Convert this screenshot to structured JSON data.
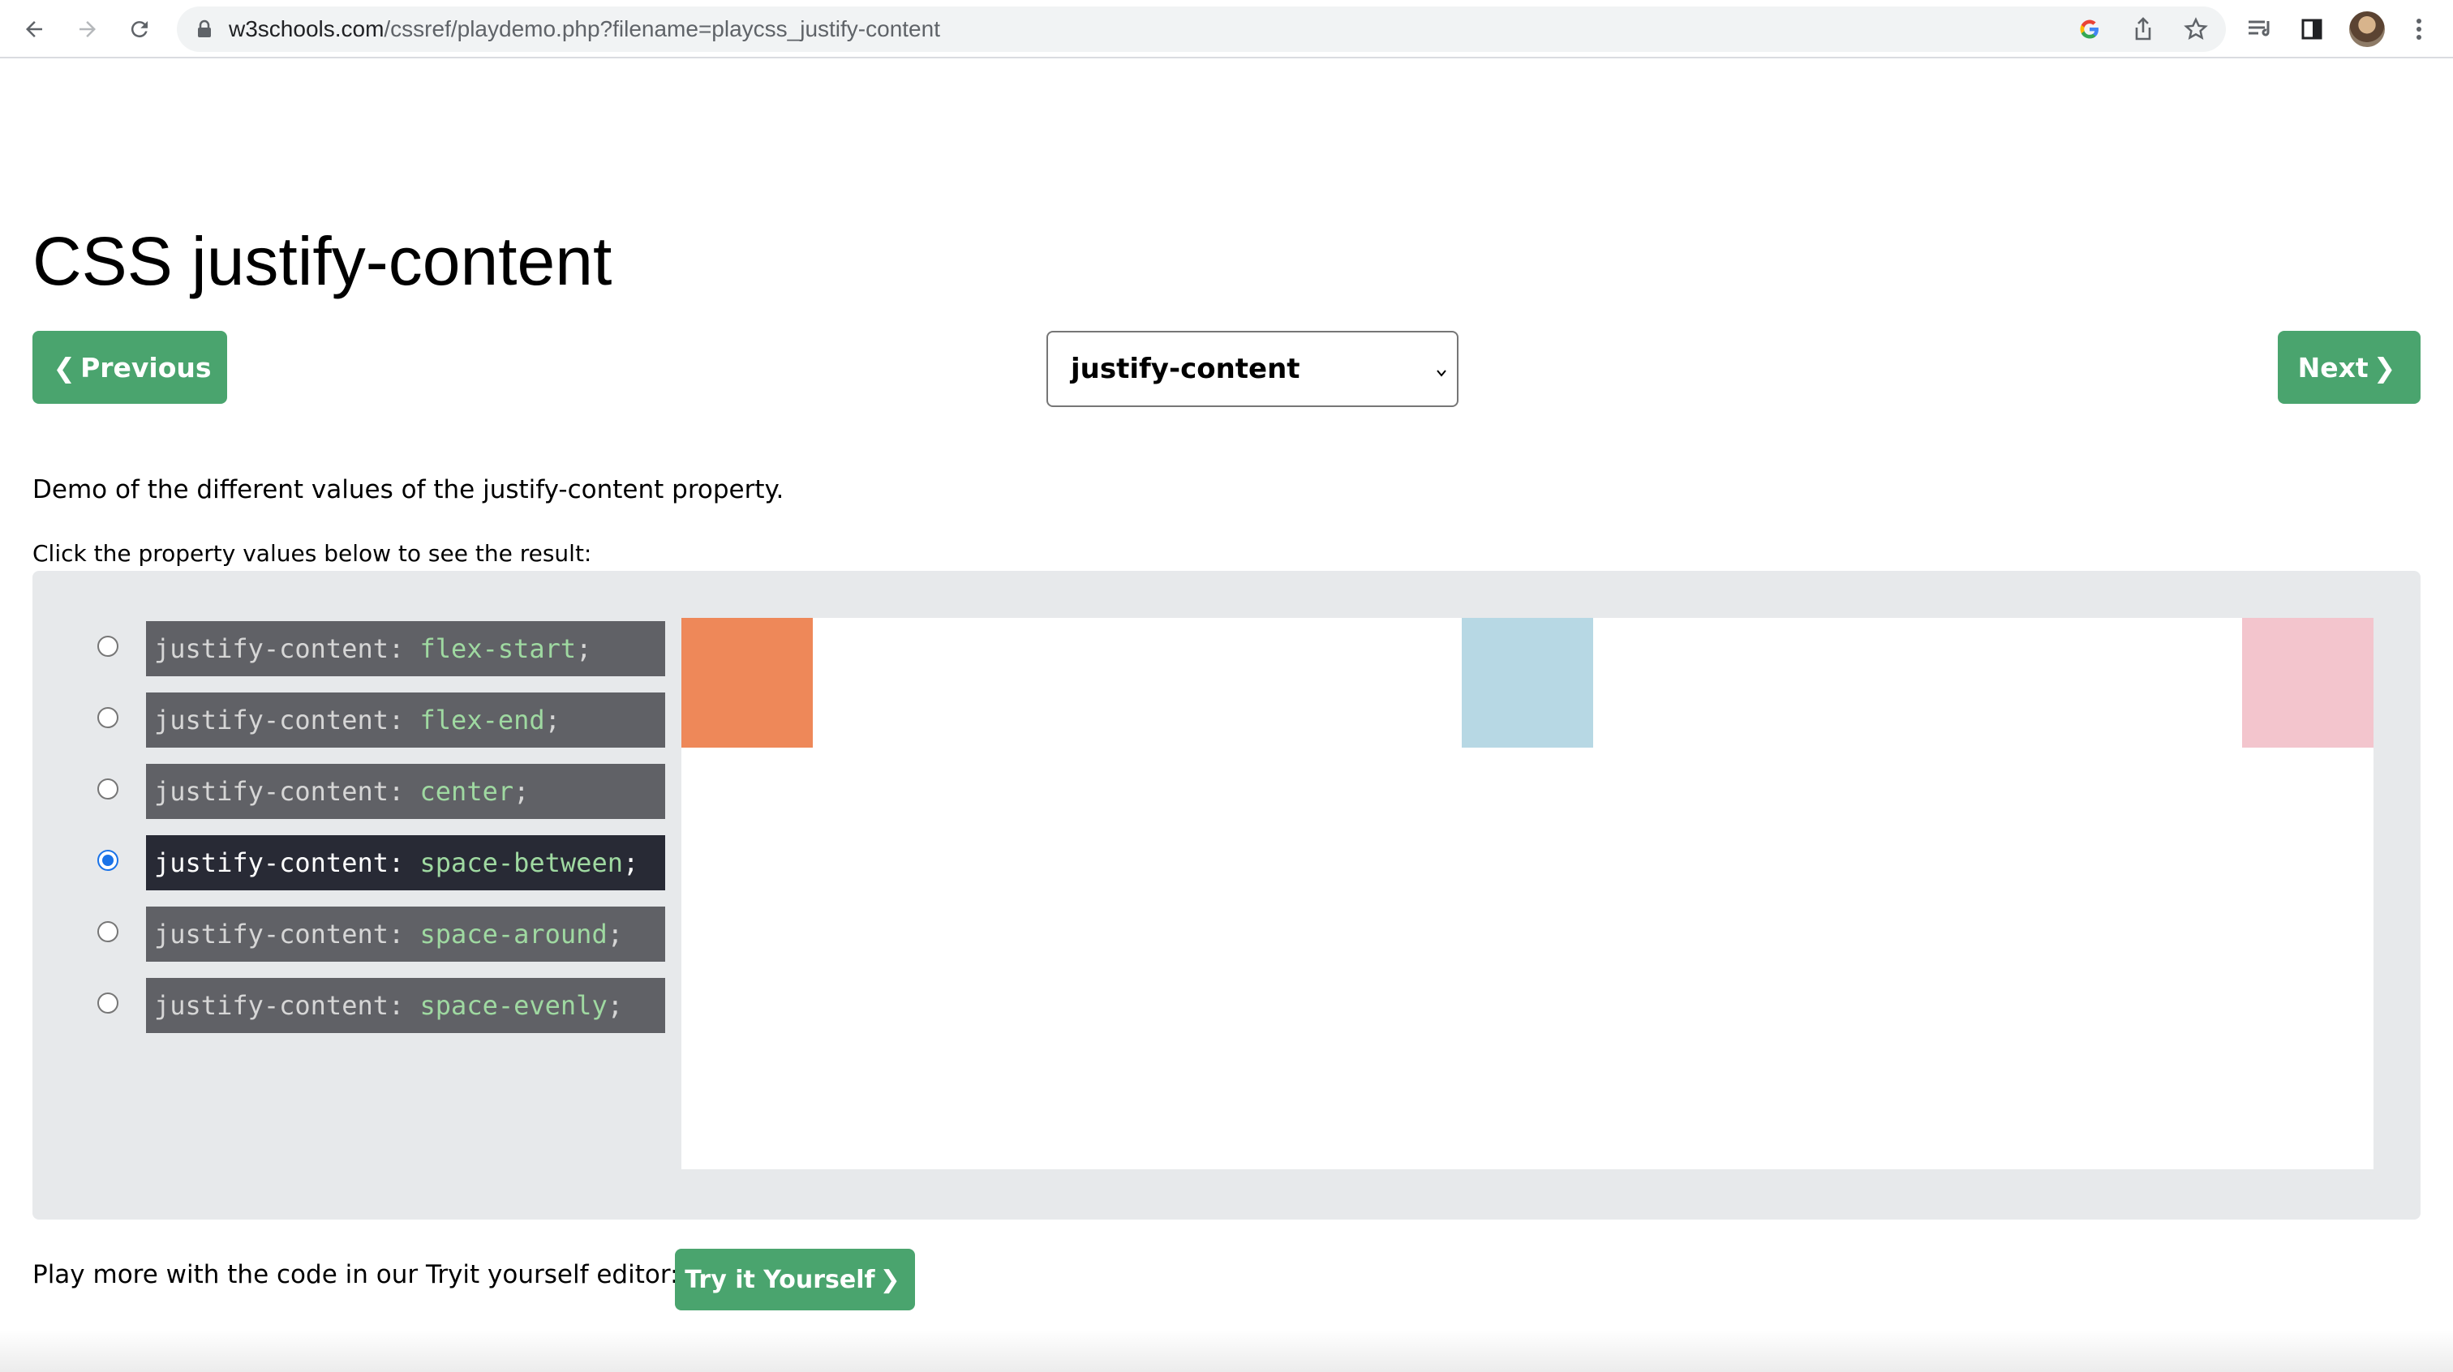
{
  "browser": {
    "url_domain": "w3schools.com",
    "url_path": "/cssref/playdemo.php?filename=playcss_justify-content"
  },
  "page": {
    "title": "CSS justify-content",
    "prev_label": "Previous",
    "next_label": "Next",
    "select_value": "justify-content",
    "description": "Demo of the different values of the justify-content property.",
    "instruction": "Click the property values below to see the result:",
    "play_text": "Play more with the code in our Tryit yourself editor:",
    "try_label": "Try it Yourself"
  },
  "options": [
    {
      "property": "justify-content",
      "value": "flex-start",
      "checked": false
    },
    {
      "property": "justify-content",
      "value": "flex-end",
      "checked": false
    },
    {
      "property": "justify-content",
      "value": "center",
      "checked": false
    },
    {
      "property": "justify-content",
      "value": "space-between",
      "checked": true
    },
    {
      "property": "justify-content",
      "value": "space-around",
      "checked": false
    },
    {
      "property": "justify-content",
      "value": "space-evenly",
      "checked": false
    }
  ],
  "demo_boxes": [
    {
      "color": "#ee8859"
    },
    {
      "color": "#b7d8e4"
    },
    {
      "color": "#f3c5cd"
    }
  ],
  "colors": {
    "accent_green": "#4aa46e",
    "code_bg": "#606166",
    "code_bg_active": "#282a35",
    "code_value": "#9fd9a1",
    "panel_bg": "#e7e9eb"
  }
}
